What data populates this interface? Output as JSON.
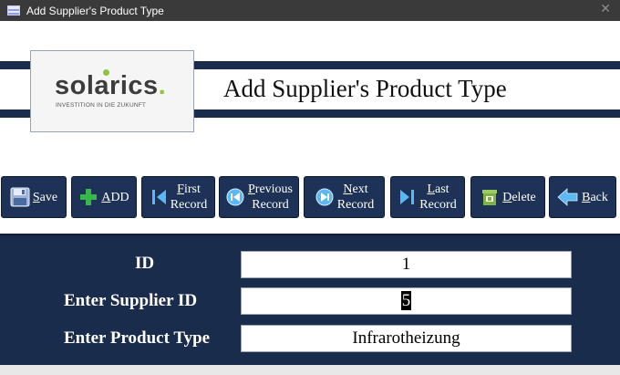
{
  "window": {
    "title": "Add Supplier's Product Type",
    "close_glyph": "✕"
  },
  "logo": {
    "word": "solarics",
    "end_dot": ".",
    "tagline": "INVESTITION IN DIE ZUKUNFT"
  },
  "header": {
    "title": "Add Supplier's Product Type"
  },
  "toolbar": {
    "save": "Save",
    "add": "ADD",
    "first": "First\nRecord",
    "previous": "Previous\nRecord",
    "next": "Next\nRecord",
    "last": "Last\nRecord",
    "delete": "Delete",
    "back": "Back"
  },
  "form": {
    "id_label": "ID",
    "id_value": "1",
    "supplier_label": "Enter Supplier ID",
    "supplier_value": "5",
    "product_label": "Enter Product Type",
    "product_value": "Infrarotheizung"
  },
  "colors": {
    "navy": "#1a2c4b",
    "accent_green": "#8cc63f",
    "button_blue": "#1d3256"
  }
}
